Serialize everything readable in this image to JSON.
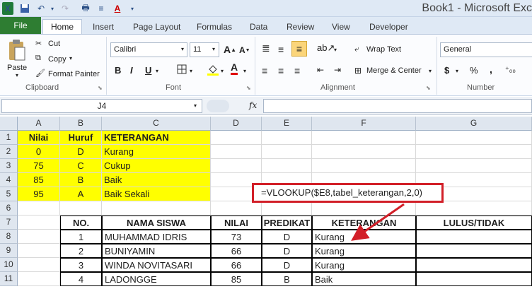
{
  "window": {
    "title": "Book1 - Microsoft Exc"
  },
  "ribbon_tabs": {
    "file": "File",
    "home": "Home",
    "insert": "Insert",
    "page_layout": "Page Layout",
    "formulas": "Formulas",
    "data": "Data",
    "review": "Review",
    "view": "View",
    "developer": "Developer"
  },
  "clipboard": {
    "paste": "Paste",
    "cut": "Cut",
    "copy": "Copy",
    "format_painter": "Format Painter",
    "label": "Clipboard"
  },
  "font": {
    "name": "Calibri",
    "size": "11",
    "label": "Font",
    "bold": "B",
    "italic": "I",
    "underline": "U"
  },
  "alignment": {
    "wrap_text": "Wrap Text",
    "merge_center": "Merge & Center",
    "label": "Alignment"
  },
  "number": {
    "format": "General",
    "currency": "$",
    "percent": "%",
    "comma": ",",
    "label": "Number"
  },
  "formula_bar": {
    "name_box": "J4",
    "fx": "fx",
    "value": ""
  },
  "columns": [
    "A",
    "B",
    "C",
    "D",
    "E",
    "F",
    "G"
  ],
  "rows": [
    "1",
    "2",
    "3",
    "4",
    "5",
    "6",
    "7",
    "8",
    "9",
    "10",
    "11"
  ],
  "lookup_table": {
    "headers": [
      "Nilai",
      "Huruf",
      "KETERANGAN"
    ],
    "rows": [
      [
        "0",
        "D",
        "Kurang"
      ],
      [
        "75",
        "C",
        "Cukup"
      ],
      [
        "85",
        "B",
        "Baik"
      ],
      [
        "95",
        "A",
        "Baik Sekali"
      ]
    ]
  },
  "callout": {
    "text": "=VLOOKUP($E8,tabel_keterangan,2,0)",
    "color": "#d21f28"
  },
  "student_table": {
    "headers": [
      "NO.",
      "NAMA SISWA",
      "NILAI",
      "PREDIKAT",
      "KETERANGAN",
      "LULUS/TIDAK"
    ],
    "rows": [
      [
        "1",
        "MUHAMMAD IDRIS",
        "73",
        "D",
        "Kurang",
        ""
      ],
      [
        "2",
        "BUNIYAMIN",
        "66",
        "D",
        "Kurang",
        ""
      ],
      [
        "3",
        "WINDA NOVITASARI",
        "66",
        "D",
        "Kurang",
        ""
      ],
      [
        "4",
        "LADONGGE",
        "85",
        "B",
        "Baik",
        ""
      ]
    ]
  }
}
